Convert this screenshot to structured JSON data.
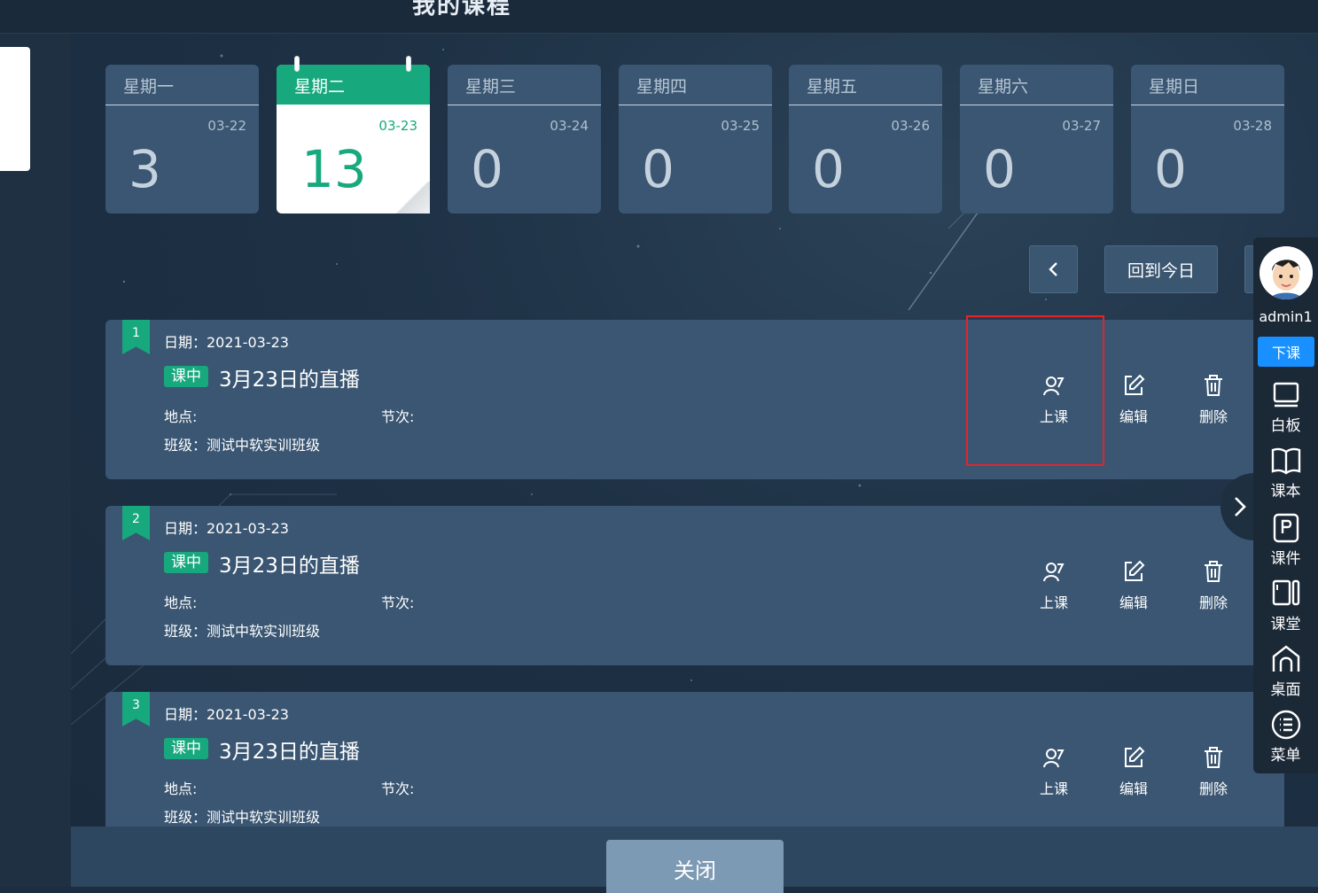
{
  "page": {
    "title": "我的课程"
  },
  "week": [
    {
      "name": "星期一",
      "date": "03-22",
      "count": "3",
      "active": false
    },
    {
      "name": "星期二",
      "date": "03-23",
      "count": "13",
      "active": true
    },
    {
      "name": "星期三",
      "date": "03-24",
      "count": "0",
      "active": false
    },
    {
      "name": "星期四",
      "date": "03-25",
      "count": "0",
      "active": false
    },
    {
      "name": "星期五",
      "date": "03-26",
      "count": "0",
      "active": false
    },
    {
      "name": "星期六",
      "date": "03-27",
      "count": "0",
      "active": false
    },
    {
      "name": "星期日",
      "date": "03-28",
      "count": "0",
      "active": false
    }
  ],
  "nav": {
    "prev_icon": "chevron-left-icon",
    "today_label": "回到今日"
  },
  "courses": [
    {
      "index": "1",
      "date": "日期：2021-03-23",
      "status": "课中",
      "title": "3月23日的直播",
      "location": "地点:",
      "section": "节次:",
      "class": "班级：测试中软实训班级"
    },
    {
      "index": "2",
      "date": "日期：2021-03-23",
      "status": "课中",
      "title": "3月23日的直播",
      "location": "地点:",
      "section": "节次:",
      "class": "班级：测试中软实训班级"
    },
    {
      "index": "3",
      "date": "日期：2021-03-23",
      "status": "课中",
      "title": "3月23日的直播",
      "location": "地点:",
      "section": "节次:",
      "class": "班级：测试中软实训班级"
    }
  ],
  "actions": {
    "start": "上课",
    "edit": "编辑",
    "delete": "删除"
  },
  "footer": {
    "close_label": "关闭"
  },
  "toolbar": {
    "username": "admin1",
    "end_class": "下课",
    "items": [
      {
        "label": "白板",
        "icon": "whiteboard-icon"
      },
      {
        "label": "课本",
        "icon": "book-icon"
      },
      {
        "label": "课件",
        "icon": "courseware-icon"
      },
      {
        "label": "课堂",
        "icon": "classroom-icon"
      },
      {
        "label": "桌面",
        "icon": "desktop-icon"
      },
      {
        "label": "菜单",
        "icon": "menu-icon"
      }
    ]
  },
  "colors": {
    "accent": "#17a97d",
    "card": "#3a5672",
    "highlight": "#e5232b",
    "primary": "#1890ff"
  }
}
